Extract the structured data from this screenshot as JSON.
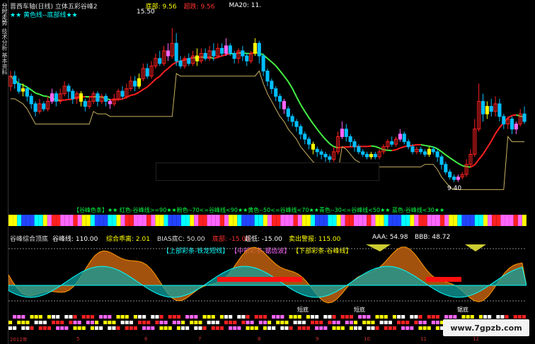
{
  "side_tabs": [
    {
      "label": "分时走势"
    },
    {
      "label": "技术分析"
    },
    {
      "label": "基本资料"
    }
  ],
  "header": {
    "title": "晋西车轴(日线) 立体五彩谷峰2",
    "bottom_label": "底部: 9.56",
    "super_label": "超跌: 9.56",
    "ma_label": "MA20: 11."
  },
  "legend": {
    "text": "★★ 黄色线--底部线★★"
  },
  "price": {
    "peak": "15.50",
    "low": "9.40"
  },
  "band_legend": {
    "text": "【谷峰色条】★★ 红色-谷峰线>=90★★粉色--70<=谷峰线<90★★黄色--50<=谷峰线<70★★青色--30<=谷峰线<50★★ 蓝色-谷峰线<30★★"
  },
  "sub_header": {
    "name": "谷峰综合顶底",
    "gufeng": "谷峰线: 110.00",
    "zonghe": "综合乖离: 2.01",
    "bias": "BIAS底C: 50.00",
    "dibu": "底部: -15.00",
    "chaodi": "超低: -15.00",
    "maichu": "卖出警报: 115.00",
    "aaa": "AAA: 54.98",
    "bbb": "BBB: 48.72"
  },
  "sub_legend": {
    "a": "【上部彩条-铁龙短线】",
    "b": "【中部彩条-锯齿波】",
    "c": "【下部彩条-谷峰线】"
  },
  "sub_labels": {
    "short1": "短底",
    "short2": "短底",
    "short3": "锯底"
  },
  "axis": {
    "start": "2012年",
    "m1": "5",
    "m2": "6",
    "m3": "7",
    "m4": "8",
    "m5": "9",
    "m6": "10",
    "m7": "11",
    "m8": "12"
  },
  "watermark": {
    "text": "www.7gpzb.com"
  },
  "colors": {
    "up": "#ff2020",
    "down": "#00bfff",
    "yellow": "#ffff00",
    "green_ma": "#44ee44",
    "red_ma": "#ff2020",
    "base_line": "#c8b060"
  },
  "chart_data": {
    "type": "candlestick",
    "candles": [
      [
        13.2,
        13.6,
        13.8,
        13.0
      ],
      [
        13.6,
        13.3,
        13.8,
        13.1
      ],
      [
        13.3,
        13.0,
        13.5,
        12.9
      ],
      [
        13.0,
        13.1,
        13.3,
        12.8
      ],
      [
        13.1,
        12.8,
        13.2,
        12.6
      ],
      [
        12.8,
        12.5,
        12.9,
        12.3
      ],
      [
        12.5,
        12.2,
        12.6,
        12.0
      ],
      [
        12.2,
        12.5,
        12.7,
        12.1
      ],
      [
        12.5,
        12.3,
        12.6,
        12.2
      ],
      [
        12.3,
        12.6,
        12.8,
        12.2
      ],
      [
        12.6,
        12.9,
        13.1,
        12.5
      ],
      [
        12.9,
        12.6,
        13.0,
        12.4
      ],
      [
        12.6,
        12.9,
        13.1,
        12.5
      ],
      [
        12.9,
        13.2,
        13.4,
        12.8
      ],
      [
        13.2,
        13.0,
        13.3,
        12.7
      ],
      [
        13.0,
        12.7,
        13.1,
        12.5
      ],
      [
        12.7,
        12.9,
        13.0,
        12.5
      ],
      [
        12.9,
        12.6,
        13.0,
        12.4
      ],
      [
        12.6,
        12.4,
        12.7,
        12.2
      ],
      [
        12.4,
        12.6,
        12.8,
        12.3
      ],
      [
        12.6,
        12.9,
        13.0,
        12.5
      ],
      [
        12.9,
        12.6,
        13.0,
        12.4
      ],
      [
        12.6,
        12.8,
        12.9,
        12.5
      ],
      [
        12.8,
        12.6,
        12.9,
        12.4
      ],
      [
        12.6,
        12.5,
        12.7,
        12.3
      ],
      [
        12.5,
        12.7,
        12.9,
        12.4
      ],
      [
        12.7,
        13.0,
        13.1,
        12.6
      ],
      [
        13.0,
        12.8,
        13.2,
        12.7
      ],
      [
        12.8,
        13.1,
        13.3,
        12.7
      ],
      [
        13.1,
        13.4,
        13.6,
        13.0
      ],
      [
        13.4,
        13.2,
        13.6,
        13.0
      ],
      [
        13.2,
        13.5,
        13.7,
        13.1
      ],
      [
        13.5,
        13.9,
        14.1,
        13.4
      ],
      [
        13.9,
        13.6,
        14.1,
        13.5
      ],
      [
        13.6,
        14.0,
        14.2,
        13.5
      ],
      [
        14.0,
        14.3,
        14.5,
        13.9
      ],
      [
        14.3,
        14.1,
        14.6,
        14.0
      ],
      [
        14.1,
        14.6,
        14.8,
        14.0
      ],
      [
        14.6,
        14.4,
        14.9,
        14.2
      ],
      [
        14.4,
        14.9,
        15.5,
        14.3
      ],
      [
        14.9,
        14.2,
        15.3,
        14.0
      ],
      [
        14.2,
        14.0,
        14.4,
        13.9
      ],
      [
        14.0,
        14.3,
        14.4,
        13.9
      ],
      [
        14.3,
        14.1,
        14.5,
        14.0
      ],
      [
        14.1,
        14.4,
        14.6,
        14.0
      ],
      [
        14.4,
        14.2,
        14.7,
        14.0
      ],
      [
        14.2,
        14.5,
        14.7,
        14.1
      ],
      [
        14.5,
        14.3,
        14.7,
        14.2
      ],
      [
        14.3,
        14.6,
        14.8,
        14.2
      ],
      [
        14.6,
        14.4,
        14.9,
        14.2
      ],
      [
        14.4,
        14.7,
        14.9,
        14.3
      ],
      [
        14.7,
        14.5,
        14.9,
        14.4
      ],
      [
        14.5,
        14.8,
        15.1,
        14.4
      ],
      [
        14.8,
        14.5,
        14.9,
        14.4
      ],
      [
        14.5,
        14.3,
        14.6,
        14.1
      ],
      [
        14.3,
        14.6,
        14.7,
        14.1
      ],
      [
        14.6,
        14.4,
        14.8,
        14.2
      ],
      [
        14.4,
        14.2,
        14.5,
        14.0
      ],
      [
        14.2,
        14.5,
        14.6,
        14.1
      ],
      [
        14.5,
        14.9,
        15.1,
        14.4
      ],
      [
        14.9,
        14.4,
        15.0,
        14.1
      ],
      [
        14.4,
        13.8,
        14.5,
        13.6
      ],
      [
        13.8,
        13.4,
        13.9,
        13.2
      ],
      [
        13.4,
        13.1,
        13.5,
        12.9
      ],
      [
        13.1,
        12.8,
        13.2,
        12.6
      ],
      [
        12.8,
        12.6,
        12.9,
        12.3
      ],
      [
        12.6,
        12.3,
        12.7,
        12.1
      ],
      [
        12.3,
        12.0,
        12.4,
        11.8
      ],
      [
        12.0,
        11.8,
        12.1,
        11.6
      ],
      [
        11.8,
        11.6,
        11.9,
        11.4
      ],
      [
        11.6,
        11.3,
        11.7,
        11.1
      ],
      [
        11.3,
        11.1,
        11.4,
        10.9
      ],
      [
        11.1,
        10.9,
        11.2,
        10.7
      ],
      [
        10.9,
        10.7,
        11.0,
        10.5
      ],
      [
        10.7,
        10.6,
        10.8,
        10.4
      ],
      [
        10.6,
        10.5,
        10.7,
        10.3
      ],
      [
        10.5,
        10.4,
        10.6,
        10.2
      ],
      [
        10.4,
        10.3,
        10.5,
        10.1
      ],
      [
        10.3,
        10.6,
        10.8,
        10.2
      ],
      [
        10.6,
        11.2,
        11.4,
        10.5
      ],
      [
        11.2,
        11.5,
        11.8,
        11.1
      ],
      [
        11.5,
        11.2,
        11.7,
        11.0
      ],
      [
        11.2,
        11.0,
        11.3,
        10.8
      ],
      [
        11.0,
        10.8,
        11.1,
        10.6
      ],
      [
        10.8,
        10.6,
        10.9,
        10.5
      ],
      [
        10.6,
        10.5,
        10.7,
        10.4
      ],
      [
        10.5,
        10.4,
        10.6,
        10.3
      ],
      [
        10.4,
        10.5,
        10.6,
        10.3
      ],
      [
        10.5,
        10.4,
        10.6,
        10.3
      ],
      [
        10.4,
        10.6,
        10.7,
        10.3
      ],
      [
        10.6,
        10.8,
        10.9,
        10.5
      ],
      [
        10.8,
        11.0,
        11.1,
        10.7
      ],
      [
        11.0,
        10.9,
        11.2,
        10.8
      ],
      [
        10.9,
        11.1,
        11.2,
        10.8
      ],
      [
        11.1,
        11.3,
        11.5,
        11.0
      ],
      [
        11.3,
        11.0,
        11.4,
        10.9
      ],
      [
        11.0,
        10.8,
        11.1,
        10.7
      ],
      [
        10.8,
        10.6,
        10.9,
        10.5
      ],
      [
        10.6,
        10.7,
        10.8,
        10.5
      ],
      [
        10.7,
        10.6,
        10.8,
        10.5
      ],
      [
        10.6,
        10.5,
        10.7,
        10.4
      ],
      [
        10.5,
        10.7,
        10.8,
        10.4
      ],
      [
        10.7,
        10.6,
        10.8,
        10.5
      ],
      [
        10.6,
        10.4,
        10.7,
        10.2
      ],
      [
        10.4,
        10.1,
        10.5,
        9.9
      ],
      [
        10.1,
        9.8,
        10.2,
        9.7
      ],
      [
        9.8,
        9.6,
        9.9,
        9.5
      ],
      [
        9.6,
        9.5,
        9.7,
        9.4
      ],
      [
        9.5,
        9.6,
        9.7,
        9.4
      ],
      [
        9.6,
        9.7,
        9.8,
        9.5
      ],
      [
        9.7,
        10.1,
        10.3,
        9.6
      ],
      [
        10.1,
        10.5,
        10.7,
        10.0
      ],
      [
        10.5,
        11.5,
        11.9,
        10.4
      ],
      [
        11.5,
        12.6,
        13.3,
        11.4
      ],
      [
        12.6,
        12.1,
        12.9,
        11.8
      ],
      [
        12.1,
        12.4,
        12.6,
        11.9
      ],
      [
        12.4,
        12.2,
        12.7,
        12.0
      ],
      [
        12.2,
        12.5,
        12.8,
        12.0
      ],
      [
        12.5,
        12.0,
        12.7,
        11.8
      ],
      [
        12.0,
        11.7,
        12.1,
        11.5
      ],
      [
        11.7,
        11.9,
        12.0,
        11.5
      ],
      [
        11.9,
        11.5,
        12.0,
        11.3
      ],
      [
        11.5,
        11.7,
        11.8,
        11.3
      ],
      [
        11.7,
        12.1,
        12.3,
        11.6
      ],
      [
        12.1,
        11.8,
        12.4,
        11.7
      ]
    ],
    "ylim": [
      9.0,
      16.0
    ]
  }
}
